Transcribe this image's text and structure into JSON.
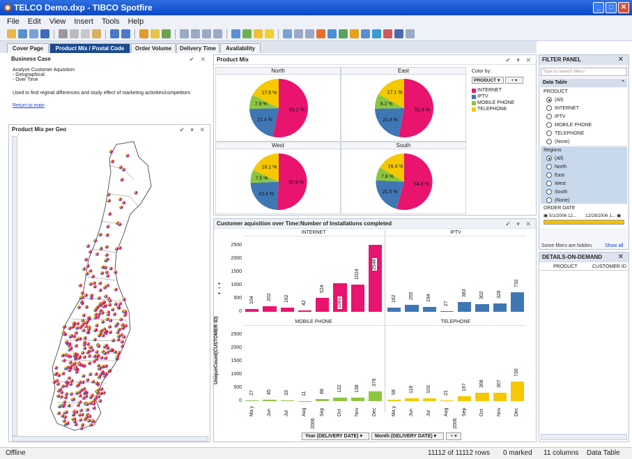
{
  "window": {
    "title": "TELCO Demo.dxp - TIBCO Spotfire"
  },
  "menu": [
    "File",
    "Edit",
    "View",
    "Insert",
    "Tools",
    "Help"
  ],
  "tabs": [
    "Cover Page",
    "Product Mix / Postal Code",
    "Order Volume",
    "Delivery Time",
    "Availability"
  ],
  "business_case": {
    "title": "Business Case",
    "line1": "Analyze Customer Aquisition",
    "line2": "- Geographical",
    "line3": "- Over Time",
    "line4": "Used to find reginal differences and study effect of marketing activities/competitors",
    "link": "Return to main"
  },
  "geo_panel": {
    "title": "Product Mix per Geo"
  },
  "product_mix": {
    "title": "Product Mix",
    "color_by_label": "Color by:",
    "color_by_value": "PRODUCT",
    "legend": [
      {
        "name": "INTERNET",
        "color": "#e8146e"
      },
      {
        "name": "IPTV",
        "color": "#3f77b5"
      },
      {
        "name": "MOBILE PHONE",
        "color": "#8cc63f"
      },
      {
        "name": "TELEPHONE",
        "color": "#f5c800"
      }
    ]
  },
  "chart_data": [
    {
      "type": "pie",
      "title": "Product Mix",
      "categories": [
        "INTERNET",
        "IPTV",
        "MOBILE PHONE",
        "TELEPHONE"
      ],
      "panels": [
        {
          "name": "North",
          "values": [
            53.2,
            21.4,
            7.9,
            17.5
          ],
          "labels": [
            "53.2 %",
            "21.4 %",
            "7.9 %",
            "17.5 %"
          ]
        },
        {
          "name": "East",
          "values": [
            52.9,
            21.8,
            8.2,
            17.1
          ],
          "labels": [
            "52.9 %",
            "21.8 %",
            "8.2 %",
            "17.1 %"
          ]
        },
        {
          "name": "West",
          "values": [
            50.9,
            23.4,
            7.5,
            18.1
          ],
          "labels": [
            "50.9 %",
            "23.4 %",
            "7.5 %",
            "18.1 %"
          ]
        },
        {
          "name": "South",
          "values": [
            54.3,
            21.5,
            7.8,
            16.4
          ],
          "labels": [
            "54.3 %",
            "21.5 %",
            "7.8 %",
            "16.4 %"
          ]
        }
      ]
    },
    {
      "type": "bar",
      "title": "Customer aquisition over Time:Number of Installations completed",
      "ylabel": "UniqueCount(CUSTOMER ID)",
      "ylim": [
        0,
        2800
      ],
      "yticks": [
        "2500",
        "2000",
        "1500",
        "1000",
        "500",
        "0"
      ],
      "months": [
        "May",
        "Jun",
        "Jul",
        "Aug",
        "Sep",
        "Oct",
        "Nov",
        "Dec"
      ],
      "month_labels": [
        "Ma y",
        "Jun",
        "Jul",
        "Aug",
        "Sep",
        "Oct",
        "Nov",
        "Dec"
      ],
      "year": "2006",
      "series": [
        {
          "name": "INTERNET",
          "color": "#e8146e",
          "values": [
            104,
            202,
            162,
            42,
            524,
            1081,
            1024,
            2548
          ]
        },
        {
          "name": "IPTV",
          "color": "#3f77b5",
          "values": [
            162,
            255,
            194,
            27,
            383,
            302,
            328,
            732
          ]
        },
        {
          "name": "MOBILE PHONE",
          "color": "#8cc63f",
          "values": [
            27,
            45,
            33,
            11,
            88,
            132,
            138,
            376
          ]
        },
        {
          "name": "TELEPHONE",
          "color": "#f5c800",
          "values": [
            58,
            118,
            103,
            21,
            197,
            308,
            307,
            730
          ]
        }
      ],
      "xaxis_selectors": [
        "Year (DELIVERY DATE)",
        "Month (DELIVERY DATE)"
      ]
    }
  ],
  "filter_panel": {
    "title": "FILTER PANEL",
    "search_placeholder": "Type to search filters",
    "data_table": "Data Table",
    "product_label": "PRODUCT",
    "product_options": [
      "(All)",
      "INTERNET",
      "IPTV",
      "MOBILE PHONE",
      "TELEPHONE",
      "(None)"
    ],
    "regions_label": "Regions",
    "region_options": [
      "(All)",
      "North",
      "East",
      "West",
      "South",
      "(None)"
    ],
    "order_date_label": "ORDER DATE",
    "order_date_from": "5/1/2006 12...",
    "order_date_to": "12/28/2006 1...",
    "hidden_note": "Some filters are hidden.",
    "show_all": "Show all"
  },
  "details": {
    "title": "DETAILS-ON-DEMAND",
    "col1": "PRODUCT",
    "col2": "CUSTOMER ID"
  },
  "status": {
    "left": "Offline",
    "rows": "11112 of 11112 rows",
    "marked": "0 marked",
    "columns": "11 columns",
    "table": "Data Table"
  }
}
